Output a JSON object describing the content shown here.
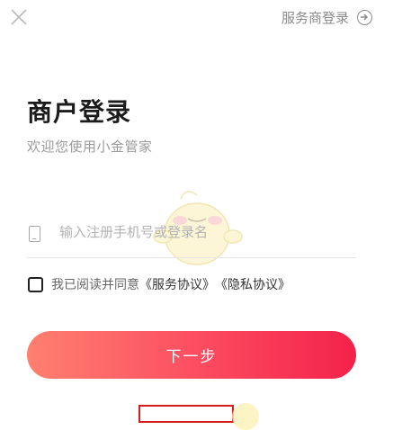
{
  "header": {
    "switch_label": "服务商登录",
    "close_icon": "close-icon",
    "arrow_icon": "arrow-right-circle-icon"
  },
  "main": {
    "title": "商户登录",
    "subtitle": "欢迎您使用小金管家",
    "phone": {
      "placeholder": "输入注册手机号或登录名",
      "value": "",
      "icon": "phone-icon"
    },
    "agreement": {
      "checked": false,
      "prefix": "我已阅读并同意",
      "service_link": "《服务协议》",
      "privacy_link": "《隐私协议》"
    },
    "next_label": "下一步"
  },
  "colors": {
    "button_start": "#ff8070",
    "button_end": "#f3224a",
    "title": "#1b1b1b",
    "muted": "#9a9a9a"
  }
}
